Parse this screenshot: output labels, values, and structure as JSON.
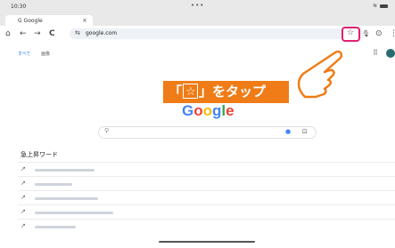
{
  "status": {
    "time": "10:30",
    "dots": "•••"
  },
  "tab": {
    "title": "G Google",
    "close": "×",
    "new_tab": "+"
  },
  "toolbar": {
    "url": "google.com",
    "home": "⌂",
    "back": "←",
    "forward": "→",
    "reload": "C",
    "tune": "⇆",
    "star": "☆",
    "mic": "🎙",
    "history": "⊙",
    "menu": "⋮"
  },
  "gnav": {
    "all": "すべて",
    "images": "画像"
  },
  "callout": {
    "prefix": "「",
    "star": "☆",
    "suffix": "」をタップ"
  },
  "logo": {
    "letters": [
      "G",
      "o",
      "o",
      "g",
      "l",
      "e"
    ],
    "colors": [
      "#4285f4",
      "#ea4335",
      "#fbbc05",
      "#4285f4",
      "#34a853",
      "#ea4335"
    ]
  },
  "search": {
    "placeholder": ""
  },
  "trending": {
    "heading": "急上昇ワード",
    "items": [
      {
        "arrow": "↗",
        "bar_fraction": 0.16
      },
      {
        "arrow": "↗",
        "bar_fraction": 0.1
      },
      {
        "arrow": "↗",
        "bar_fraction": 0.17
      },
      {
        "arrow": "↗",
        "bar_fraction": 0.21
      },
      {
        "arrow": "↗",
        "bar_fraction": 0.11
      }
    ]
  }
}
